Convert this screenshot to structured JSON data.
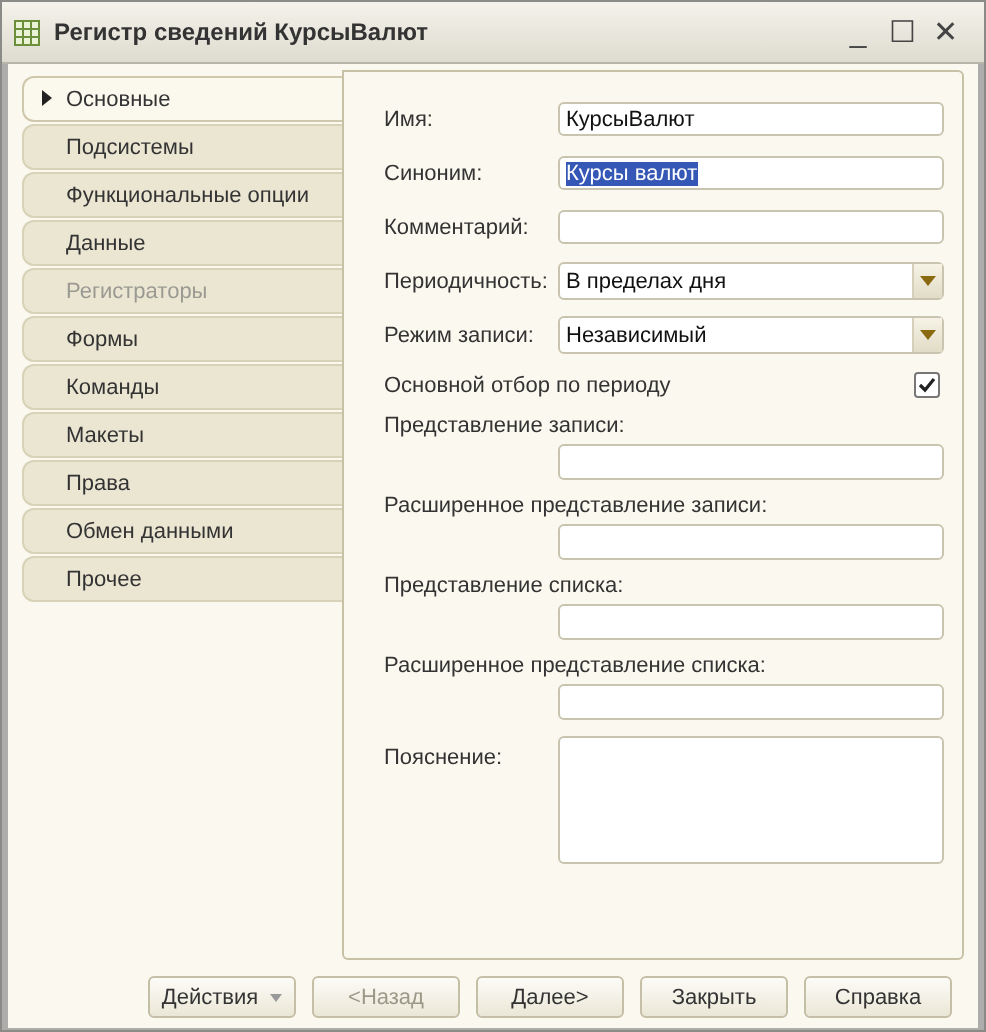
{
  "window": {
    "title": "Регистр сведений КурсыВалют",
    "controls": [
      "_",
      "☐",
      "✕"
    ]
  },
  "tabs": [
    {
      "label": "Основные",
      "selected": true,
      "disabled": false
    },
    {
      "label": "Подсистемы",
      "selected": false,
      "disabled": false
    },
    {
      "label": "Функциональные опции",
      "selected": false,
      "disabled": false
    },
    {
      "label": "Данные",
      "selected": false,
      "disabled": false
    },
    {
      "label": "Регистраторы",
      "selected": false,
      "disabled": true
    },
    {
      "label": "Формы",
      "selected": false,
      "disabled": false
    },
    {
      "label": "Команды",
      "selected": false,
      "disabled": false
    },
    {
      "label": "Макеты",
      "selected": false,
      "disabled": false
    },
    {
      "label": "Права",
      "selected": false,
      "disabled": false
    },
    {
      "label": "Обмен данными",
      "selected": false,
      "disabled": false
    },
    {
      "label": "Прочее",
      "selected": false,
      "disabled": false
    }
  ],
  "fields": [
    {
      "kind": "text",
      "label": "Имя:",
      "value": "КурсыВалют"
    },
    {
      "kind": "text",
      "label": "Синоним:",
      "value": "Курсы валют",
      "text_selected": true
    },
    {
      "kind": "text",
      "label": "Комментарий:"
    },
    {
      "kind": "select",
      "label": "Периодичность:",
      "value": "В пределах дня"
    },
    {
      "kind": "select",
      "label": "Режим записи:",
      "value": "Независимый"
    },
    {
      "kind": "checkbox",
      "label": "Основной отбор по периоду",
      "checked": true
    },
    {
      "kind": "stacked",
      "label": "Представление записи:"
    },
    {
      "kind": "stacked",
      "label": "Расширенное представление записи:"
    },
    {
      "kind": "stacked",
      "label": "Представление списка:"
    },
    {
      "kind": "stacked",
      "label": "Расширенное представление списка:"
    },
    {
      "kind": "textarea",
      "label": "Пояснение:"
    }
  ],
  "buttons": [
    {
      "label": "Действия",
      "kind": "menu",
      "disabled": false
    },
    {
      "label": "<Назад",
      "kind": "plain",
      "disabled": true
    },
    {
      "label": "Далее>",
      "kind": "plain",
      "disabled": false
    },
    {
      "label": "Закрыть",
      "kind": "plain",
      "disabled": false
    },
    {
      "label": "Справка",
      "kind": "plain",
      "disabled": false
    }
  ]
}
